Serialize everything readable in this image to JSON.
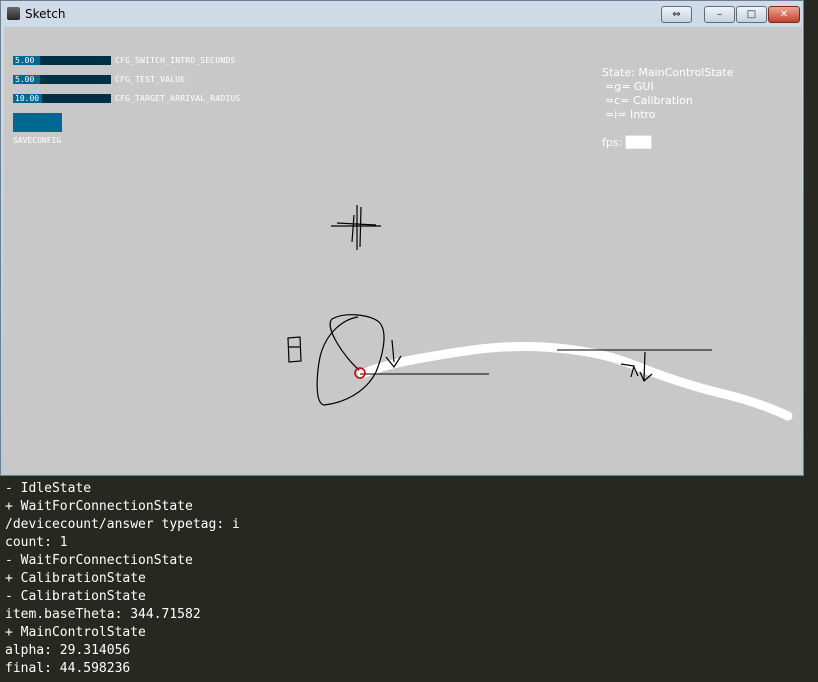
{
  "window": {
    "title": "Sketch",
    "buttons": {
      "swap": "⇔",
      "minimize": "–",
      "maximize": "□",
      "close": "✕"
    }
  },
  "controls": {
    "sliders": [
      {
        "value_text": "5.00",
        "label": "CFG_SWITCH_INTRO_SECONDS",
        "fill": 0.28
      },
      {
        "value_text": "5.00",
        "label": "CFG_TEST_VALUE",
        "fill": 0.28
      },
      {
        "value_text": "10.00",
        "label": "CFG_TARGET_ARRIVAL_RADIUS",
        "fill": 0.3
      }
    ],
    "save_label": "SAVECONFIG"
  },
  "hud": {
    "state_prefix": "State:",
    "state_value": "MainControlState",
    "help": [
      "=g= GUI",
      "=c= Calibration",
      "=i= Intro"
    ],
    "fps_prefix": "fps:",
    "fps_value": "███"
  },
  "colors": {
    "canvas": "#c8c8c8",
    "slider_bg": "#003045",
    "slider_fill": "#016891",
    "console_bg": "#272822",
    "marker": "#c80000"
  },
  "console": {
    "lines": [
      "- IdleState",
      "+ WaitForConnectionState",
      "/devicecount/answer typetag: i",
      "count: 1",
      "- WaitForConnectionState",
      "+ CalibrationState",
      "- CalibrationState",
      "item.baseTheta: 344.71582",
      "+ MainControlState",
      "alpha: 29.314056",
      "final: 44.598236"
    ]
  }
}
